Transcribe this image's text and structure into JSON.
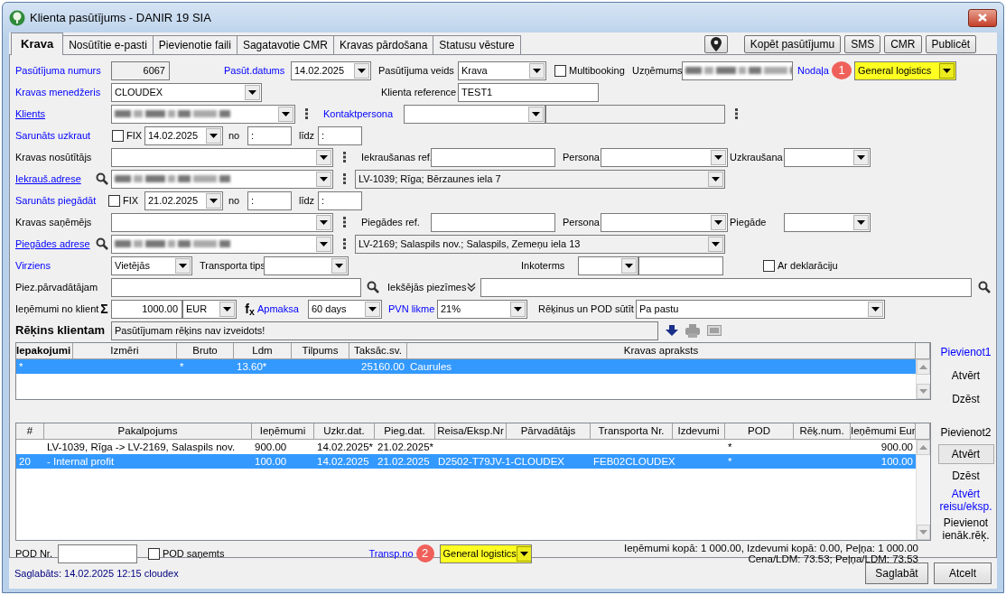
{
  "window": {
    "title": "Klienta pasūtījums - DANIR 19 SIA"
  },
  "tabs": [
    {
      "label": "Krava",
      "selected": true
    },
    {
      "label": "Nosūtītie e-pasti",
      "selected": false
    },
    {
      "label": "Pievienotie faili",
      "selected": false
    },
    {
      "label": "Sagatavotie CMR",
      "selected": false
    },
    {
      "label": "Kravas pārdošana",
      "selected": false
    },
    {
      "label": "Statusu vēsture",
      "selected": false
    }
  ],
  "toolbar": [
    {
      "kind": "pin"
    },
    {
      "kind": "text",
      "label": "Kopēt pasūtījumu"
    },
    {
      "kind": "text",
      "label": "SMS"
    },
    {
      "kind": "text",
      "label": "CMR"
    },
    {
      "kind": "text",
      "label": "Publicēt"
    }
  ],
  "form": {
    "rows": [
      {
        "items": [
          {
            "kind": "link",
            "text": "Pasūtījuma numurs"
          },
          {
            "kind": "input",
            "value": "6067",
            "readonly": true
          },
          {
            "kind": "link",
            "text": "Pasūt.datums"
          },
          {
            "kind": "combo",
            "value": "14.02.2025"
          },
          {
            "kind": "label",
            "text": "Pasūtījuma veids"
          },
          {
            "kind": "combo",
            "value": "Krava"
          },
          {
            "kind": "check",
            "text": "Multibooking",
            "checked": false
          },
          {
            "kind": "label",
            "text": "Uzņēmums"
          },
          {
            "kind": "combo",
            "redacted": true
          },
          {
            "kind": "link",
            "text": "Nodaļa"
          },
          {
            "kind": "badge",
            "text": "1"
          },
          {
            "kind": "combo",
            "value": "General logistics",
            "highlight": true
          }
        ]
      },
      {
        "items": [
          {
            "kind": "link",
            "text": "Kravas menedžeris"
          },
          {
            "kind": "combo",
            "value": "CLOUDEX"
          },
          {
            "kind": "label",
            "text": "Klienta reference"
          },
          {
            "kind": "input",
            "value": "TEST1",
            "readonly": false
          }
        ]
      },
      {
        "items": [
          {
            "kind": "link",
            "text": "Klients",
            "underlined": true
          },
          {
            "kind": "combo",
            "redacted": true
          },
          {
            "kind": "dots"
          },
          {
            "kind": "link",
            "text": "Kontaktpersona"
          },
          {
            "kind": "combo"
          },
          {
            "kind": "input",
            "readonly": true
          },
          {
            "kind": "dots"
          }
        ]
      },
      {
        "items": [
          {
            "kind": "link",
            "text": "Sarunāts uzkraut"
          },
          {
            "kind": "check",
            "text": "FIX",
            "checked": false
          },
          {
            "kind": "combo",
            "value": "14.02.2025"
          },
          {
            "kind": "label",
            "text": "no"
          },
          {
            "kind": "input",
            "value": ":",
            "readonly": false
          },
          {
            "kind": "label",
            "text": "līdz"
          },
          {
            "kind": "input",
            "value": ":",
            "readonly": false
          }
        ]
      },
      {
        "items": [
          {
            "kind": "label",
            "text": "Kravas nosūtītājs"
          },
          {
            "kind": "combo"
          },
          {
            "kind": "dots"
          },
          {
            "kind": "label",
            "text": "Iekraušanas ref."
          },
          {
            "kind": "input",
            "readonly": false
          },
          {
            "kind": "label",
            "text": "Persona"
          },
          {
            "kind": "combo"
          },
          {
            "kind": "label",
            "text": "Uzkraušana"
          },
          {
            "kind": "combo"
          }
        ]
      },
      {
        "items": [
          {
            "kind": "link",
            "text": "Iekrauš.adrese",
            "underlined": true
          },
          {
            "kind": "search"
          },
          {
            "kind": "combo",
            "redacted": true
          },
          {
            "kind": "dots"
          },
          {
            "kind": "combo",
            "value": "LV-1039; Rīga; Bērzaunes iela 7",
            "readonly": true
          }
        ]
      },
      {
        "items": [
          {
            "kind": "link",
            "text": "Sarunāts piegādāt"
          },
          {
            "kind": "check",
            "text": "FIX",
            "checked": false
          },
          {
            "kind": "combo",
            "value": "21.02.2025"
          },
          {
            "kind": "label",
            "text": "no"
          },
          {
            "kind": "input",
            "value": ":",
            "readonly": false
          },
          {
            "kind": "label",
            "text": "līdz"
          },
          {
            "kind": "input",
            "value": ":",
            "readonly": false
          }
        ]
      },
      {
        "items": [
          {
            "kind": "label",
            "text": "Kravas saņēmējs"
          },
          {
            "kind": "combo"
          },
          {
            "kind": "dots"
          },
          {
            "kind": "label",
            "text": "Piegādes ref."
          },
          {
            "kind": "input",
            "readonly": false
          },
          {
            "kind": "label",
            "text": "Persona"
          },
          {
            "kind": "combo"
          },
          {
            "kind": "label",
            "text": "Piegāde"
          },
          {
            "kind": "combo"
          }
        ]
      },
      {
        "items": [
          {
            "kind": "link",
            "text": "Piegādes adrese",
            "underlined": true
          },
          {
            "kind": "search"
          },
          {
            "kind": "combo",
            "redacted": true
          },
          {
            "kind": "dots"
          },
          {
            "kind": "combo",
            "value": "LV-2169; Salaspils nov.; Salaspils, Zemeņu iela 13",
            "readonly": true
          }
        ]
      },
      {
        "items": [
          {
            "kind": "link",
            "text": "Virziens"
          },
          {
            "kind": "combo",
            "value": "Vietējās"
          },
          {
            "kind": "label",
            "text": "Transporta tips"
          },
          {
            "kind": "combo"
          },
          {
            "kind": "label",
            "text": "Inkoterms"
          },
          {
            "kind": "combo"
          },
          {
            "kind": "input",
            "readonly": false
          },
          {
            "kind": "check",
            "text": "Ar deklarāciju",
            "checked": false
          }
        ]
      },
      {
        "items": [
          {
            "kind": "label",
            "text": "Piez.pārvadātājam"
          },
          {
            "kind": "input",
            "readonly": false
          },
          {
            "kind": "search"
          },
          {
            "kind": "label",
            "text": "Iekšējās piezīmes"
          },
          {
            "kind": "chevrons"
          },
          {
            "kind": "input",
            "readonly": false
          },
          {
            "kind": "search"
          }
        ]
      },
      {
        "items": [
          {
            "kind": "label",
            "text": "Ieņēmumi no klient"
          },
          {
            "kind": "symbol",
            "text": "Σ"
          },
          {
            "kind": "input",
            "value": "1000.00",
            "readonly": false
          },
          {
            "kind": "combo",
            "value": "EUR"
          },
          {
            "kind": "symbol",
            "text": "f$_{x}$"
          },
          {
            "kind": "link",
            "text": "Apmaksa"
          },
          {
            "kind": "combo",
            "value": "60 days"
          },
          {
            "kind": "link",
            "text": "PVN likme"
          },
          {
            "kind": "combo",
            "value": "21%"
          },
          {
            "kind": "label",
            "text": "Rēķinus un POD sūtīt"
          },
          {
            "kind": "combo",
            "value": "Pa pastu"
          }
        ]
      },
      {
        "items": [
          {
            "kind": "title",
            "text": "Rēķins klientam"
          },
          {
            "kind": "input",
            "value": "Pasūtījumam rēķins nav izveidots!",
            "readonly": true
          },
          {
            "kind": "down-arrow"
          },
          {
            "kind": "printer"
          },
          {
            "kind": "card"
          }
        ]
      }
    ]
  },
  "cargo_table": {
    "columns": [
      "Iepakojumi",
      "Izmēri",
      "Bruto",
      "Ldm",
      "Tilpums",
      "Taksāc.sv.",
      "Kravas apraksts"
    ],
    "rows": [
      {
        "selected": true,
        "cells": [
          "*",
          null,
          "*",
          "13.60*",
          null,
          "25160.00",
          "Caurules"
        ]
      }
    ],
    "actions": [
      {
        "kind": "link",
        "label": "Pievienot1"
      },
      {
        "kind": "flat",
        "label": "Atvērt"
      },
      {
        "kind": "flat",
        "label": "Dzēst"
      }
    ]
  },
  "services_table": {
    "columns": [
      "#",
      "Pakalpojums",
      "Ieņēmumi",
      "Uzkr.dat.",
      "Pieg.dat.",
      "Reisa/Eksp.Nr",
      "Pārvadātājs",
      "Transporta Nr.",
      "Izdevumi",
      "POD",
      "Rēķ.num.",
      "Ieņēmumi Eur"
    ],
    "rows": [
      {
        "selected": false,
        "cells": [
          null,
          "LV-1039, Rīga -> LV-2169, Salaspils nov.",
          "900.00",
          "14.02.2025*",
          "21.02.2025*",
          null,
          null,
          null,
          null,
          "*",
          null,
          "900.00"
        ]
      },
      {
        "selected": true,
        "cells": [
          "20",
          "- Internal profit",
          "100.00",
          "14.02.2025",
          "21.02.2025",
          "D2502-T79JV-1-CLOUDEX",
          null,
          "FEB02CLOUDEX",
          null,
          "*",
          null,
          "100.00"
        ]
      }
    ],
    "actions": [
      {
        "kind": "flat",
        "label": "Pievienot2"
      },
      {
        "kind": "button",
        "label": "Atvērt"
      },
      {
        "kind": "flat",
        "label": "Dzēst"
      },
      {
        "kind": "link",
        "label": "Atvērt reisu/eksp."
      },
      {
        "kind": "flat",
        "label": "Pievienot ienāk.rēķ."
      }
    ]
  },
  "footer": {
    "pod_label": "POD Nr.",
    "pod_check": {
      "text": "POD saņemts",
      "checked": false
    },
    "transp_label": "Transp.no",
    "badge": "2",
    "transp_value": "General logistics",
    "totals": [
      "Ieņēmumi kopā: 1 000.00, Izdevumi kopā: 0.00, Peļņa: 1 000.00",
      "Cena/LDM: 73.53; Peļņa/LDM: 73.53"
    ]
  },
  "status_bar": {
    "text": "Saglabāts: 14.02.2025 12:15 cloudex",
    "buttons": [
      "Saglabāt",
      "Atcelt"
    ]
  }
}
